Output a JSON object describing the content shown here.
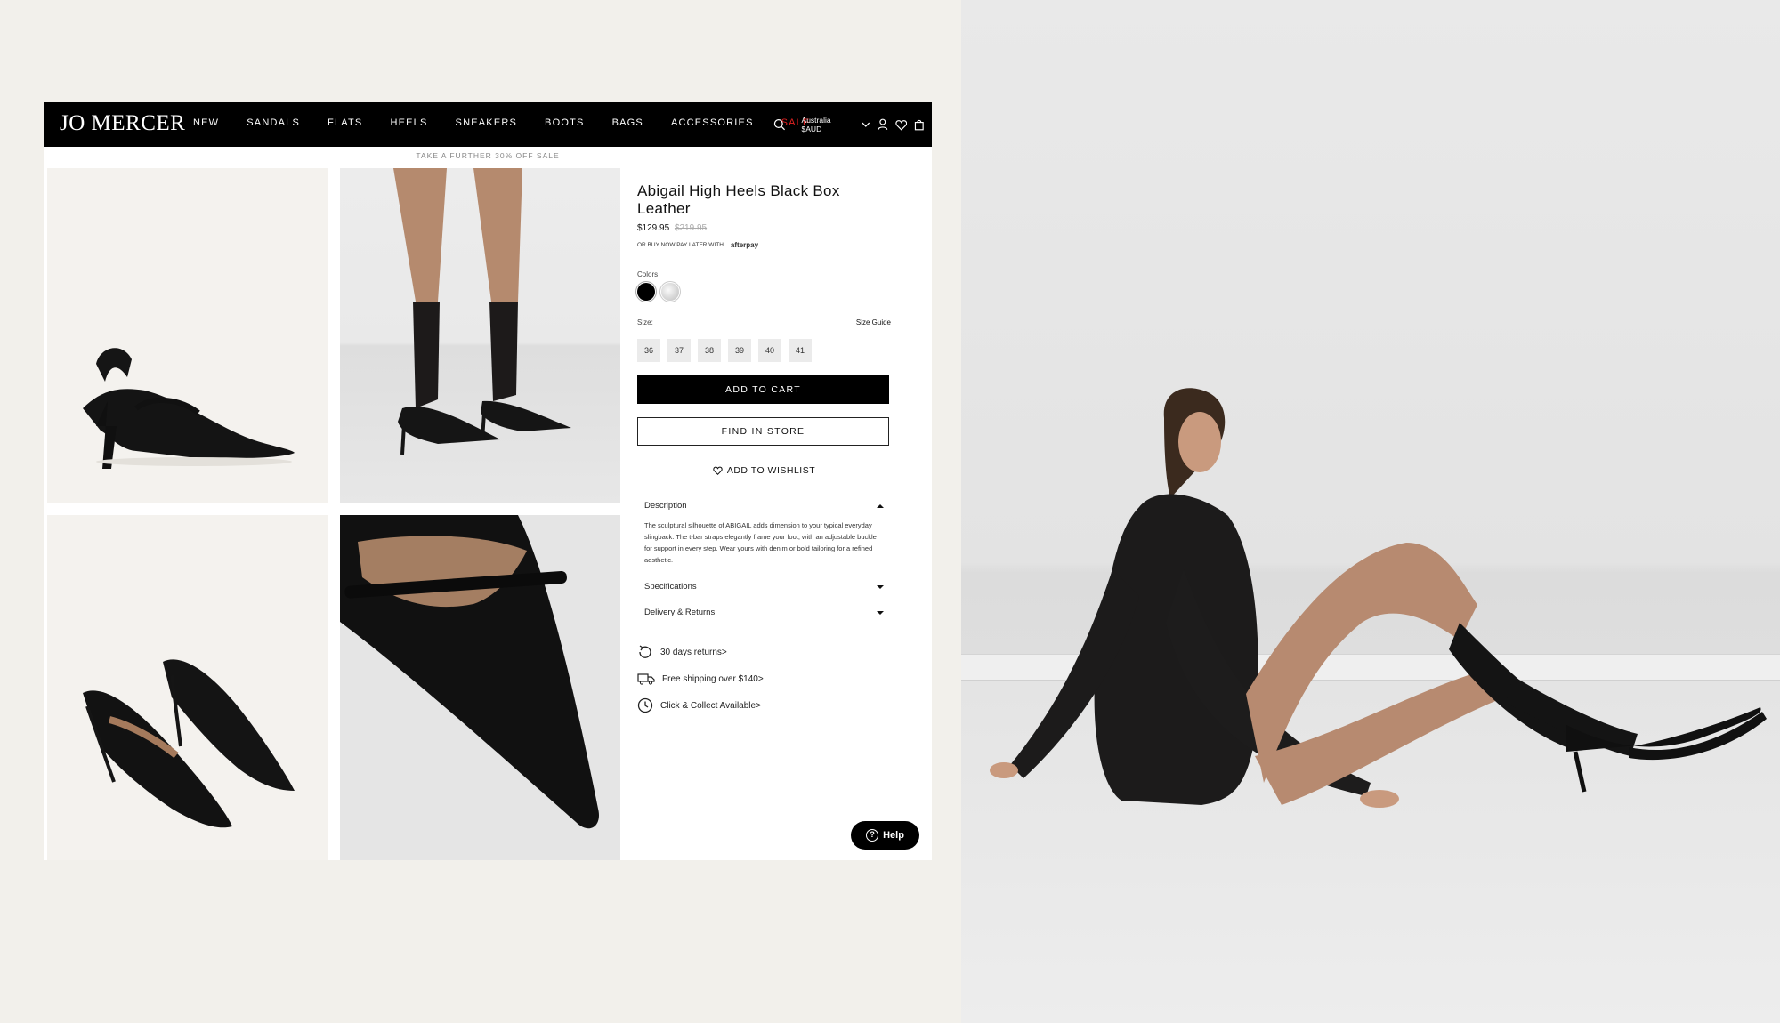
{
  "brand": {
    "logo": "JO MERCER"
  },
  "nav": {
    "links": [
      "NEW",
      "SANDALS",
      "FLATS",
      "HEELS",
      "SNEAKERS",
      "BOOTS",
      "BAGS",
      "ACCESSORIES"
    ],
    "sale": "SALE",
    "region": "Australia $AUD",
    "icons": [
      "search-icon",
      "chevron-down-icon",
      "account-icon",
      "wishlist-icon",
      "bag-icon"
    ]
  },
  "promo": "TAKE A FURTHER 30% OFF SALE",
  "product": {
    "title": "Abigail High Heels Black Box Leather",
    "price": "$129.95",
    "old_price": "$219.95",
    "afterpay_text": "OR BUY NOW PAY LATER WITH",
    "afterpay_brand": "afterpay",
    "colors_label": "Colors",
    "colors": [
      "#000000",
      "#c8c8c8"
    ],
    "size_label": "Size:",
    "size_guide": "Size Guide",
    "sizes": [
      "36",
      "37",
      "38",
      "39",
      "40",
      "41"
    ],
    "add_to_cart": "ADD TO CART",
    "find_in_store": "FIND IN STORE",
    "add_to_wishlist": "ADD TO WISHLIST",
    "description_label": "Description",
    "description": "The sculptural silhouette of ABIGAIL adds dimension to your typical everyday slingback. The t-bar straps elegantly frame your foot, with an adjustable buckle for support in every step. Wear yours with denim or bold tailoring for a refined aesthetic.",
    "specifications_label": "Specifications",
    "delivery_label": "Delivery & Returns",
    "features": [
      "30 days returns>",
      "Free shipping over $140>",
      "Click & Collect Available>"
    ]
  },
  "help": {
    "label": "Help"
  },
  "colors": {
    "nav_bg": "#000000",
    "sale": "#e32222",
    "page_bg": "#f2f0eb"
  }
}
